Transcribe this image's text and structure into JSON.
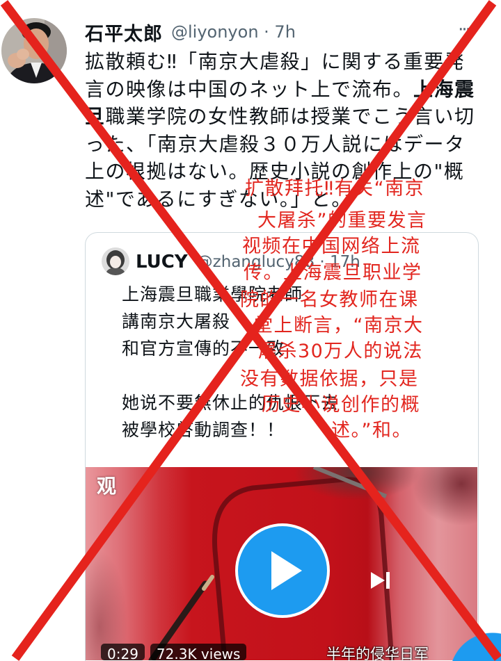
{
  "tweet": {
    "author_name": "石平太郎",
    "handle_time": "@liyonyon · 7h",
    "more_icon": "more-icon",
    "more_label": "···",
    "text_lines": [
      [
        "拡散頼む‼「南京大虐殺」に関する重要発"
      ],
      [
        "言の映像は中国のネット上で流布。",
        "上海震"
      ],
      [
        "旦",
        "職業学院の女性教師は授業でこう言い切"
      ],
      [
        "った、「南京大虐殺３０万人説にはデータ"
      ],
      [
        "上の根拠はない。歴史小説の創作上の\"概"
      ],
      [
        "述\"であるにすぎない。」と。"
      ]
    ],
    "quoted_tweet": {
      "author_name": "LUCY",
      "handle_time": "@zhanglucy88 · 17h",
      "text_lines": [
        "上海震旦職業學院老師",
        "講南京大屠殺",
        "和官方宣傳的不一致",
        "她说不要無休止的仇恨下去",
        "被學校啓動調查！！"
      ],
      "video": {
        "logo": "观",
        "play_icon": "play-icon",
        "skip_icon": "skip-forward-icon",
        "duration": "0:29",
        "views": "72.3K views",
        "subtitle": "半年的侵华日军"
      }
    }
  },
  "compose_icon": "compose-button",
  "overlay": {
    "cross_icon": "red-cross-mark",
    "translation_lines": [
      "扩散拜托‼有关“南京",
      "大屠杀”的重要发言",
      "视频在中国网络上流",
      "传。上海震旦职业学",
      "院的一名女教师在课",
      "堂上断言，“南京大",
      "屠杀30万人的说法",
      "没有数据依据，只是",
      "历史小说创作的概",
      "述。”和。"
    ]
  },
  "colors": {
    "text": "#0f1419",
    "secondary": "#536471",
    "border": "#cfd9de",
    "accent": "#1d9bf0",
    "cross": "#e5231d",
    "overlay_text": "#e2261f"
  }
}
